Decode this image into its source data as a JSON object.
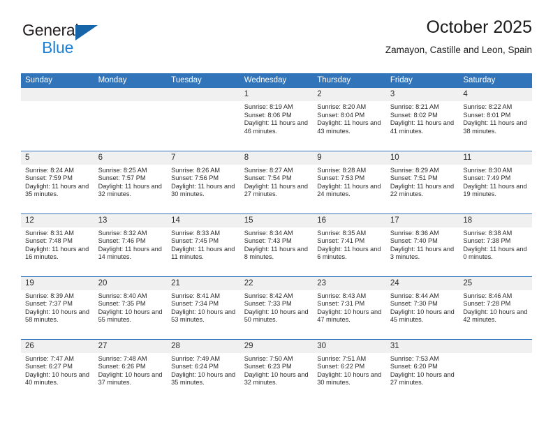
{
  "brand": {
    "name_top": "General",
    "name_bottom": "Blue",
    "triangle_color": "#1665a8",
    "blue_color": "#1b7fd4"
  },
  "header": {
    "title": "October 2025",
    "subtitle": "Zamayon, Castille and Leon, Spain"
  },
  "theme": {
    "header_bg": "#3174b9",
    "header_text": "#ffffff",
    "daynum_bg": "#f0f0f0",
    "grid_line": "#3174b9"
  },
  "weekday_headers": [
    "Sunday",
    "Monday",
    "Tuesday",
    "Wednesday",
    "Thursday",
    "Friday",
    "Saturday"
  ],
  "weeks": [
    [
      {
        "day": "",
        "empty": true
      },
      {
        "day": "",
        "empty": true
      },
      {
        "day": "",
        "empty": true
      },
      {
        "day": "1",
        "sunrise": "Sunrise: 8:19 AM",
        "sunset": "Sunset: 8:06 PM",
        "daylight": "Daylight: 11 hours and 46 minutes."
      },
      {
        "day": "2",
        "sunrise": "Sunrise: 8:20 AM",
        "sunset": "Sunset: 8:04 PM",
        "daylight": "Daylight: 11 hours and 43 minutes."
      },
      {
        "day": "3",
        "sunrise": "Sunrise: 8:21 AM",
        "sunset": "Sunset: 8:02 PM",
        "daylight": "Daylight: 11 hours and 41 minutes."
      },
      {
        "day": "4",
        "sunrise": "Sunrise: 8:22 AM",
        "sunset": "Sunset: 8:01 PM",
        "daylight": "Daylight: 11 hours and 38 minutes."
      }
    ],
    [
      {
        "day": "5",
        "sunrise": "Sunrise: 8:24 AM",
        "sunset": "Sunset: 7:59 PM",
        "daylight": "Daylight: 11 hours and 35 minutes."
      },
      {
        "day": "6",
        "sunrise": "Sunrise: 8:25 AM",
        "sunset": "Sunset: 7:57 PM",
        "daylight": "Daylight: 11 hours and 32 minutes."
      },
      {
        "day": "7",
        "sunrise": "Sunrise: 8:26 AM",
        "sunset": "Sunset: 7:56 PM",
        "daylight": "Daylight: 11 hours and 30 minutes."
      },
      {
        "day": "8",
        "sunrise": "Sunrise: 8:27 AM",
        "sunset": "Sunset: 7:54 PM",
        "daylight": "Daylight: 11 hours and 27 minutes."
      },
      {
        "day": "9",
        "sunrise": "Sunrise: 8:28 AM",
        "sunset": "Sunset: 7:53 PM",
        "daylight": "Daylight: 11 hours and 24 minutes."
      },
      {
        "day": "10",
        "sunrise": "Sunrise: 8:29 AM",
        "sunset": "Sunset: 7:51 PM",
        "daylight": "Daylight: 11 hours and 22 minutes."
      },
      {
        "day": "11",
        "sunrise": "Sunrise: 8:30 AM",
        "sunset": "Sunset: 7:49 PM",
        "daylight": "Daylight: 11 hours and 19 minutes."
      }
    ],
    [
      {
        "day": "12",
        "sunrise": "Sunrise: 8:31 AM",
        "sunset": "Sunset: 7:48 PM",
        "daylight": "Daylight: 11 hours and 16 minutes."
      },
      {
        "day": "13",
        "sunrise": "Sunrise: 8:32 AM",
        "sunset": "Sunset: 7:46 PM",
        "daylight": "Daylight: 11 hours and 14 minutes."
      },
      {
        "day": "14",
        "sunrise": "Sunrise: 8:33 AM",
        "sunset": "Sunset: 7:45 PM",
        "daylight": "Daylight: 11 hours and 11 minutes."
      },
      {
        "day": "15",
        "sunrise": "Sunrise: 8:34 AM",
        "sunset": "Sunset: 7:43 PM",
        "daylight": "Daylight: 11 hours and 8 minutes."
      },
      {
        "day": "16",
        "sunrise": "Sunrise: 8:35 AM",
        "sunset": "Sunset: 7:41 PM",
        "daylight": "Daylight: 11 hours and 6 minutes."
      },
      {
        "day": "17",
        "sunrise": "Sunrise: 8:36 AM",
        "sunset": "Sunset: 7:40 PM",
        "daylight": "Daylight: 11 hours and 3 minutes."
      },
      {
        "day": "18",
        "sunrise": "Sunrise: 8:38 AM",
        "sunset": "Sunset: 7:38 PM",
        "daylight": "Daylight: 11 hours and 0 minutes."
      }
    ],
    [
      {
        "day": "19",
        "sunrise": "Sunrise: 8:39 AM",
        "sunset": "Sunset: 7:37 PM",
        "daylight": "Daylight: 10 hours and 58 minutes."
      },
      {
        "day": "20",
        "sunrise": "Sunrise: 8:40 AM",
        "sunset": "Sunset: 7:35 PM",
        "daylight": "Daylight: 10 hours and 55 minutes."
      },
      {
        "day": "21",
        "sunrise": "Sunrise: 8:41 AM",
        "sunset": "Sunset: 7:34 PM",
        "daylight": "Daylight: 10 hours and 53 minutes."
      },
      {
        "day": "22",
        "sunrise": "Sunrise: 8:42 AM",
        "sunset": "Sunset: 7:33 PM",
        "daylight": "Daylight: 10 hours and 50 minutes."
      },
      {
        "day": "23",
        "sunrise": "Sunrise: 8:43 AM",
        "sunset": "Sunset: 7:31 PM",
        "daylight": "Daylight: 10 hours and 47 minutes."
      },
      {
        "day": "24",
        "sunrise": "Sunrise: 8:44 AM",
        "sunset": "Sunset: 7:30 PM",
        "daylight": "Daylight: 10 hours and 45 minutes."
      },
      {
        "day": "25",
        "sunrise": "Sunrise: 8:46 AM",
        "sunset": "Sunset: 7:28 PM",
        "daylight": "Daylight: 10 hours and 42 minutes."
      }
    ],
    [
      {
        "day": "26",
        "sunrise": "Sunrise: 7:47 AM",
        "sunset": "Sunset: 6:27 PM",
        "daylight": "Daylight: 10 hours and 40 minutes."
      },
      {
        "day": "27",
        "sunrise": "Sunrise: 7:48 AM",
        "sunset": "Sunset: 6:26 PM",
        "daylight": "Daylight: 10 hours and 37 minutes."
      },
      {
        "day": "28",
        "sunrise": "Sunrise: 7:49 AM",
        "sunset": "Sunset: 6:24 PM",
        "daylight": "Daylight: 10 hours and 35 minutes."
      },
      {
        "day": "29",
        "sunrise": "Sunrise: 7:50 AM",
        "sunset": "Sunset: 6:23 PM",
        "daylight": "Daylight: 10 hours and 32 minutes."
      },
      {
        "day": "30",
        "sunrise": "Sunrise: 7:51 AM",
        "sunset": "Sunset: 6:22 PM",
        "daylight": "Daylight: 10 hours and 30 minutes."
      },
      {
        "day": "31",
        "sunrise": "Sunrise: 7:53 AM",
        "sunset": "Sunset: 6:20 PM",
        "daylight": "Daylight: 10 hours and 27 minutes."
      },
      {
        "day": "",
        "empty": true
      }
    ]
  ]
}
